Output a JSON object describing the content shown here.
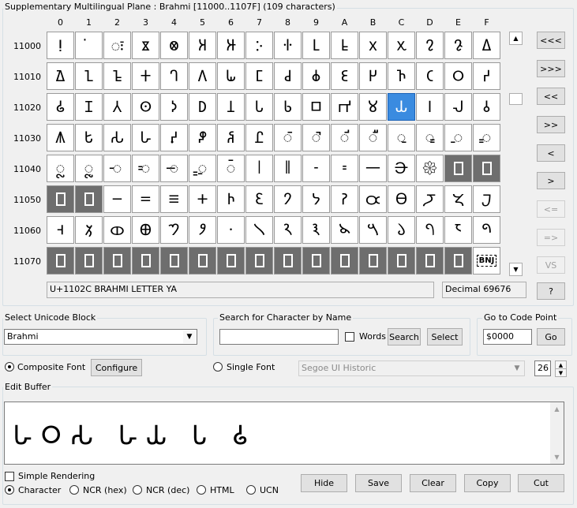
{
  "plane_title": "Supplementary Multilingual Plane : Brahmi [11000..1107F] (109 characters)",
  "column_headers": [
    "0",
    "1",
    "2",
    "3",
    "4",
    "5",
    "6",
    "7",
    "8",
    "9",
    "A",
    "B",
    "C",
    "D",
    "E",
    "F"
  ],
  "row_headers": [
    "11000",
    "11010",
    "11020",
    "11030",
    "11040",
    "11050",
    "11060",
    "11070"
  ],
  "grid": [
    [
      "ⵑ",
      "̇",
      "ः",
      "𑀃",
      "𑀄",
      "𑀅",
      "𑀆",
      "𑀇",
      "𑀈",
      "𑀉",
      "𑀊",
      "𑀋",
      "𑀌",
      "𑀍",
      "𑀎",
      "𑀏"
    ],
    [
      "𑀐",
      "𑀑",
      "𑀒",
      "𑀓",
      "𑀔",
      "𑀕",
      "𑀖",
      "𑀗",
      "𑀘",
      "𑀙",
      "𑀚",
      "𑀛",
      "𑀜",
      "𑀝",
      "𑀞",
      "𑀟"
    ],
    [
      "𑀠",
      "𑀡",
      "𑀢",
      "𑀣",
      "𑀤",
      "𑀥",
      "𑀦",
      "𑀧",
      "𑀨",
      "𑀩",
      "𑀪",
      "𑀫",
      "𑀬",
      "𑀭",
      "𑀮",
      "𑀯"
    ],
    [
      "𑀰",
      "𑀱",
      "𑀲",
      "𑀳",
      "𑀴",
      "𑀵",
      "𑀶",
      "𑀷",
      "𑀸",
      "𑀹",
      "𑀺",
      "𑀻",
      "𑀼",
      "𑀽",
      "𑀾",
      "𑀿"
    ],
    [
      "𑁀",
      "𑁁",
      "𑁂",
      "𑁃",
      "𑁄",
      "𑁅",
      "𑁆",
      "𑁇",
      "𑁈",
      "𑁉",
      "𑁊",
      "𑁋",
      "𑁌",
      "𑁍",
      "",
      ""
    ],
    [
      "",
      "",
      "𑁒",
      "𑁓",
      "𑁔",
      "𑁕",
      "𑁖",
      "𑁗",
      "𑁘",
      "𑁙",
      "𑁚",
      "𑁛",
      "𑁜",
      "𑁝",
      "𑁞",
      "𑁟"
    ],
    [
      "𑁠",
      "𑁡",
      "𑁢",
      "𑁣",
      "𑁤",
      "𑁥",
      "𑁦",
      "𑁧",
      "𑁨",
      "𑁩",
      "𑁪",
      "𑁫",
      "𑁬",
      "𑁭",
      "𑁮",
      "𑁯"
    ],
    [
      "",
      "",
      "",
      "",
      "",
      "",
      "",
      "",
      "",
      "",
      "",
      "",
      "",
      "",
      "",
      "BNJ"
    ]
  ],
  "grid_state": {
    "undefined_cells": [
      [
        4,
        14
      ],
      [
        4,
        15
      ],
      [
        5,
        0
      ],
      [
        5,
        1
      ],
      [
        7,
        0
      ],
      [
        7,
        1
      ],
      [
        7,
        2
      ],
      [
        7,
        3
      ],
      [
        7,
        4
      ],
      [
        7,
        5
      ],
      [
        7,
        6
      ],
      [
        7,
        7
      ],
      [
        7,
        8
      ],
      [
        7,
        9
      ],
      [
        7,
        10
      ],
      [
        7,
        11
      ],
      [
        7,
        12
      ],
      [
        7,
        13
      ],
      [
        7,
        14
      ]
    ],
    "selected_cell": [
      2,
      12
    ],
    "bnj_cell": [
      7,
      15
    ]
  },
  "nav_buttons": [
    "<<<",
    ">>>",
    "<<",
    ">>",
    "<",
    ">",
    "<=",
    "=>",
    "VS",
    "?"
  ],
  "nav_disabled": [
    "<=",
    "=>",
    "VS"
  ],
  "char_info": "U+1102C BRAHMI LETTER YA",
  "decimal_info": "Decimal 69676",
  "select_block": {
    "title": "Select Unicode Block",
    "value": "Brahmi"
  },
  "search": {
    "title": "Search for Character by Name",
    "value": "",
    "words_label": "Words",
    "search_button": "Search",
    "select_button": "Select"
  },
  "goto": {
    "title": "Go to Code Point",
    "value": "$0000",
    "go_button": "Go"
  },
  "font": {
    "composite_label": "Composite Font",
    "configure_button": "Configure",
    "single_label": "Single Font",
    "single_font_value": "Segoe UI Historic",
    "font_size": "26",
    "selected": "composite"
  },
  "edit_buffer": {
    "title": "Edit Buffer",
    "text": "𑀳𑀞𑀲 𑀳𑀬 𑀧 𑀠"
  },
  "simple_rendering_label": "Simple Rendering",
  "output_format": {
    "options": [
      "Character",
      "NCR (hex)",
      "NCR (dec)",
      "HTML",
      "UCN"
    ],
    "selected": "Character"
  },
  "action_buttons": [
    "Hide",
    "Save",
    "Clear",
    "Copy",
    "Cut"
  ]
}
